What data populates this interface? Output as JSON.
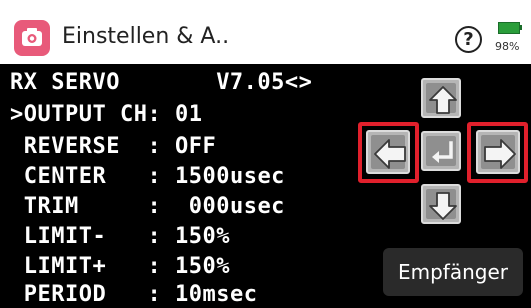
{
  "header": {
    "title": "Einstellen & A..",
    "battery_percent": "98%",
    "app_icon": "camera-icon",
    "help_label": "?"
  },
  "screen": {
    "title_left": "RX SERVO",
    "version": "V7.05<>",
    "rows": [
      {
        "cursor": ">",
        "label": "OUTPUT CH",
        "sep": ": ",
        "value": "01"
      },
      {
        "cursor": " ",
        "label": "REVERSE  ",
        "sep": ": ",
        "value": "OFF"
      },
      {
        "cursor": " ",
        "label": "CENTER   ",
        "sep": ": ",
        "value": "1500usec"
      },
      {
        "cursor": " ",
        "label": "TRIM     ",
        "sep": ": ",
        "value": " 000usec"
      },
      {
        "cursor": " ",
        "label": "LIMIT-   ",
        "sep": ": ",
        "value": "150%"
      },
      {
        "cursor": " ",
        "label": "LIMIT+   ",
        "sep": ": ",
        "value": "150%"
      },
      {
        "cursor": " ",
        "label": "PERIOD   ",
        "sep": ": ",
        "value": "10msec"
      }
    ]
  },
  "nav": {
    "up_icon": "arrow-up-icon",
    "down_icon": "arrow-down-icon",
    "left_icon": "arrow-left-icon",
    "right_icon": "arrow-right-icon",
    "enter_icon": "enter-icon",
    "highlight_color": "#e1202c"
  },
  "footer": {
    "empfaenger_label": "Empfänger"
  }
}
